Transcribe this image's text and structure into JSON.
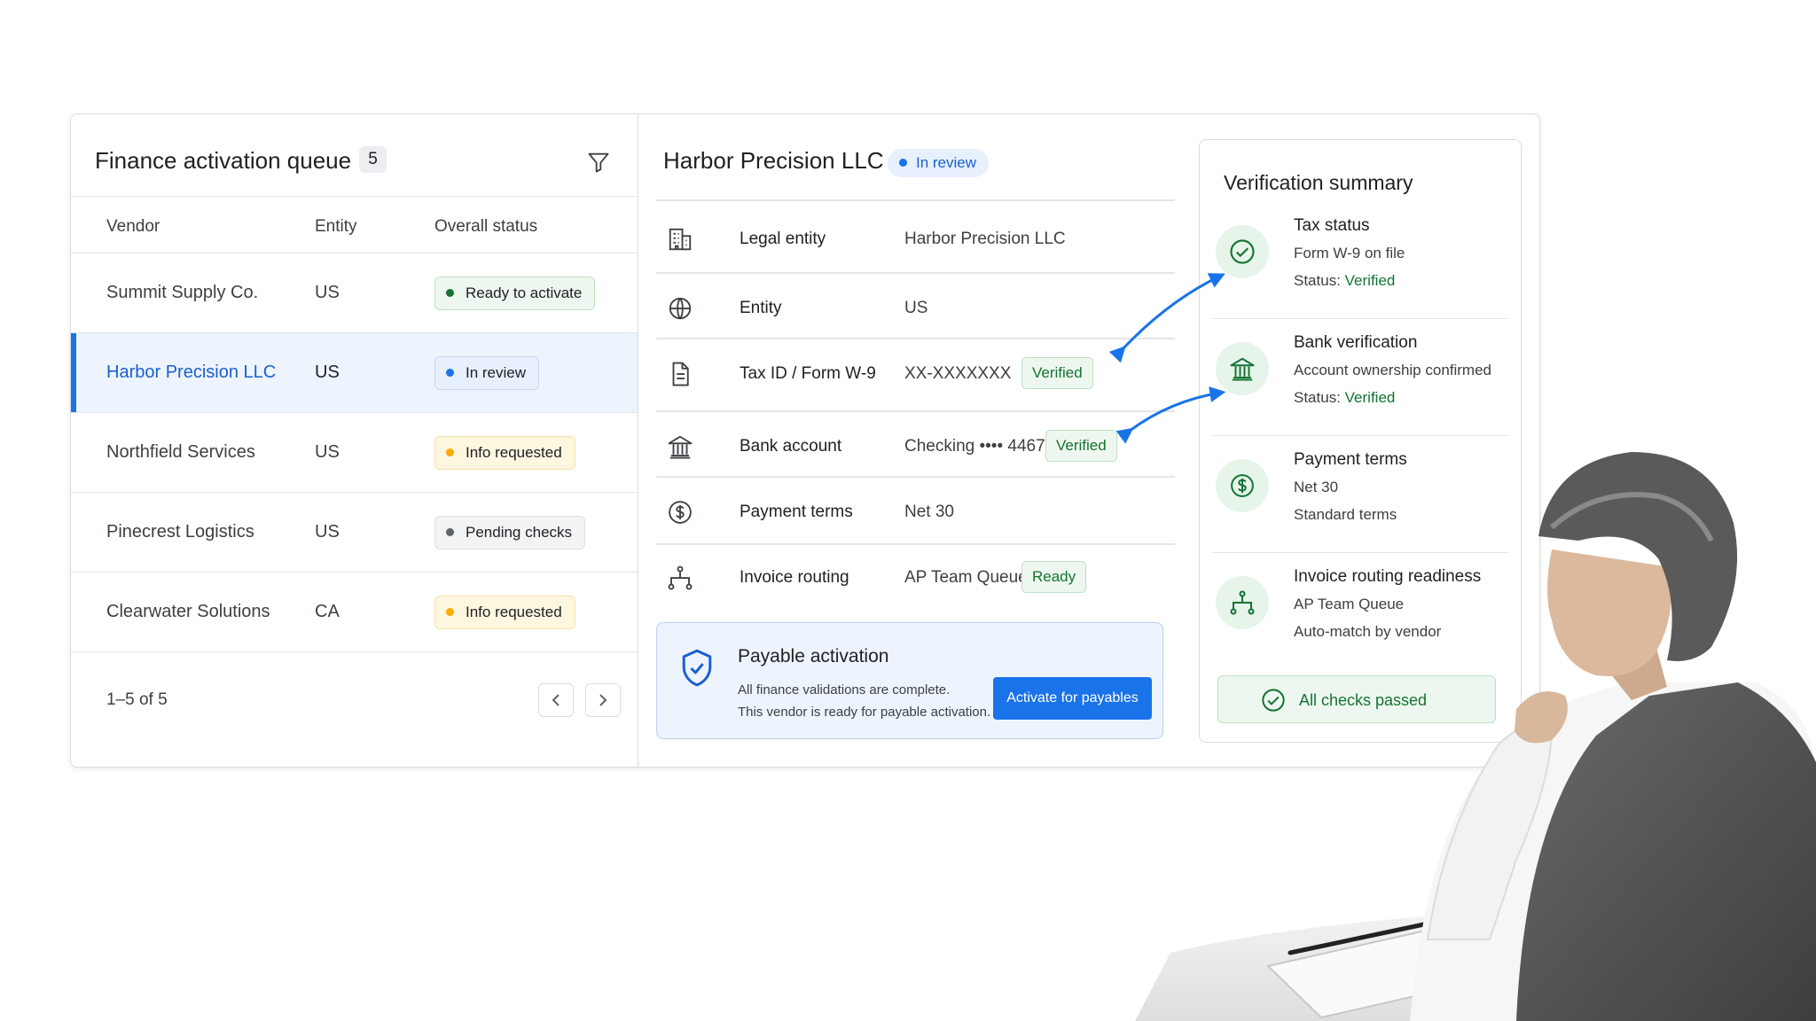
{
  "queue": {
    "title": "Finance activation queue",
    "count": "5",
    "columns": {
      "vendor": "Vendor",
      "entity": "Entity",
      "status": "Overall status"
    },
    "rows": [
      {
        "vendor": "Summit Supply Co.",
        "entity": "US",
        "status": "Ready to activate"
      },
      {
        "vendor": "Harbor Precision LLC",
        "entity": "US",
        "status": "In review"
      },
      {
        "vendor": "Northfield Services",
        "entity": "US",
        "status": "Info requested"
      },
      {
        "vendor": "Pinecrest Logistics",
        "entity": "US",
        "status": "Pending checks"
      },
      {
        "vendor": "Clearwater Solutions",
        "entity": "CA",
        "status": "Info requested"
      }
    ],
    "pagination": "1–5 of 5"
  },
  "detail": {
    "title": "Harbor Precision LLC",
    "status": "In review",
    "fields": [
      {
        "label": "Legal entity",
        "value": "Harbor Precision LLC"
      },
      {
        "label": "Entity",
        "value": "US"
      },
      {
        "label": "Tax ID / Form W-9",
        "value": "XX-XXXXXXX",
        "tag": "Verified"
      },
      {
        "label": "Bank account",
        "value": "Checking •••• 4467",
        "tag": "Verified"
      },
      {
        "label": "Payment terms",
        "value": "Net 30"
      },
      {
        "label": "Invoice routing",
        "value": "AP Team Queue",
        "tag": "Ready"
      }
    ],
    "activation": {
      "title": "Payable activation",
      "line1": "All finance validations are complete.",
      "line2": "This vendor is ready for payable activation.",
      "button": "Activate for payables"
    }
  },
  "summary": {
    "title": "Verification summary",
    "items": [
      {
        "name": "Tax status",
        "line1": "Form W-9 on file",
        "status_label": "Status:",
        "status_value": "Verified",
        "icon": "check-circle-icon"
      },
      {
        "name": "Bank verification",
        "line1": "Account ownership confirmed",
        "status_label": "Status:",
        "status_value": "Verified",
        "icon": "bank-icon"
      },
      {
        "name": "Payment terms",
        "line1": "Net 30",
        "line2": "Standard terms",
        "icon": "dollar-circle-icon"
      },
      {
        "name": "Invoice routing readiness",
        "line1": "AP Team Queue",
        "line2": "Auto-match by vendor",
        "icon": "routing-icon"
      }
    ],
    "all_passed": "All checks passed"
  },
  "colors": {
    "accent": "#1a73e8",
    "success": "#137333",
    "warning": "#f9ab00"
  }
}
